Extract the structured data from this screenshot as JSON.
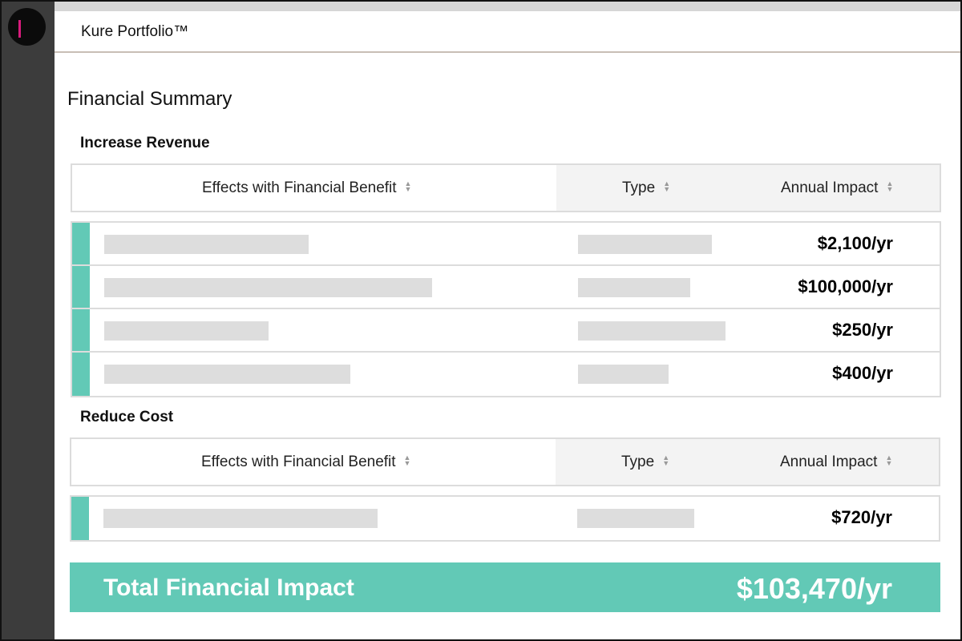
{
  "app": {
    "title": "Kure Portfolio™"
  },
  "page": {
    "title": "Financial Summary"
  },
  "columns": {
    "effects": "Effects with Financial Benefit",
    "type": "Type",
    "impact": "Annual Impact"
  },
  "sections": {
    "increase_revenue": {
      "title": "Increase Revenue",
      "rows": [
        {
          "impact": "$2,100/yr"
        },
        {
          "impact": "$100,000/yr"
        },
        {
          "impact": "$250/yr"
        },
        {
          "impact": "$400/yr"
        }
      ]
    },
    "reduce_cost": {
      "title": "Reduce Cost",
      "rows": [
        {
          "impact": "$720/yr"
        }
      ]
    }
  },
  "total": {
    "label": "Total Financial Impact",
    "value": "$103,470/yr"
  },
  "colors": {
    "accent": "#62c9b6",
    "sidebar": "#3c3c3c",
    "logo_mark": "#d81b7c",
    "placeholder": "#dddddd"
  },
  "icons": {
    "sort": "sort-icon",
    "logo": "logo-icon"
  }
}
